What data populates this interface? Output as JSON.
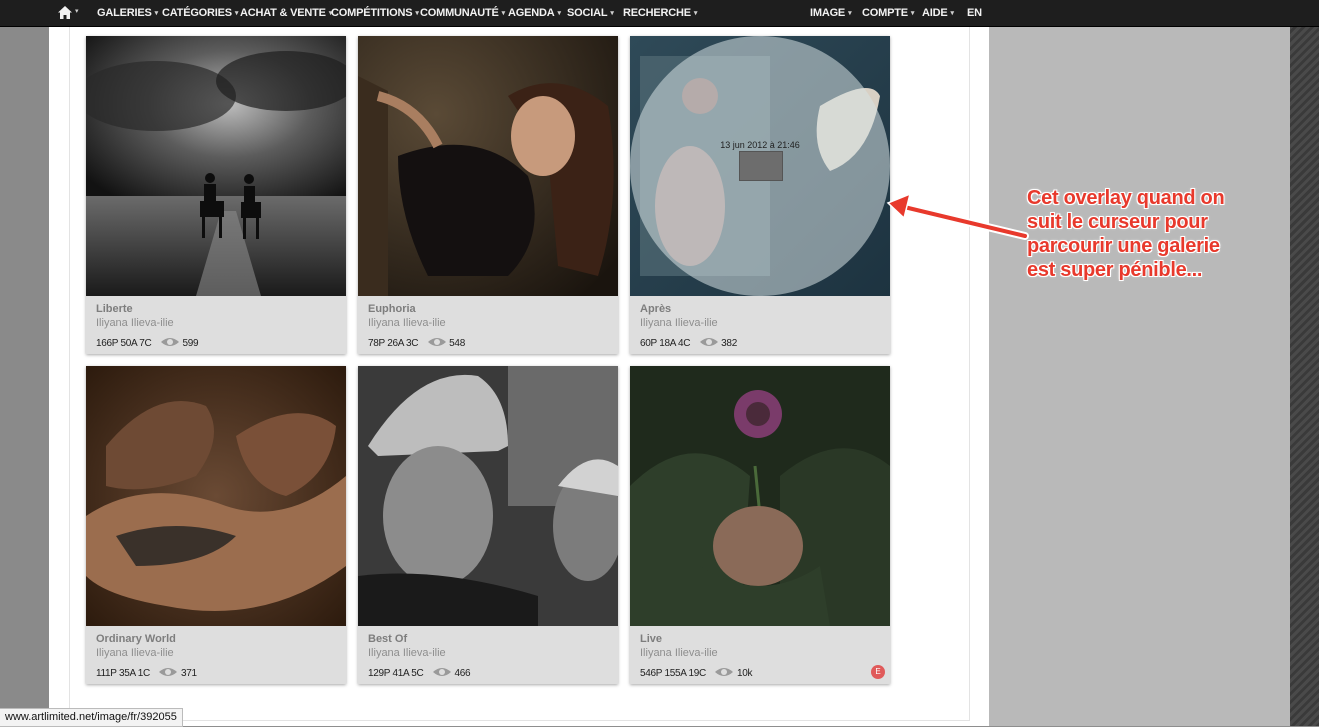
{
  "nav": {
    "left_items": [
      "GALERIES",
      "CATÉGORIES",
      "ACHAT & VENTE",
      "COMPÉTITIONS",
      "COMMUNAUTÉ",
      "AGENDA",
      "SOCIAL",
      "RECHERCHE"
    ],
    "right_items": [
      "IMAGE",
      "COMPTE",
      "AIDE"
    ],
    "language": "EN"
  },
  "cards": [
    {
      "title": "Liberte",
      "author": "Iliyana Ilieva-ilie",
      "stats": "166P 50A 7C",
      "views": "599"
    },
    {
      "title": "Euphoria",
      "author": "Iliyana Ilieva-ilie",
      "stats": "78P 26A 3C",
      "views": "548"
    },
    {
      "title": "Après",
      "author": "Iliyana Ilieva-ilie",
      "stats": "60P 18A 4C",
      "views": "382"
    },
    {
      "title": "Ordinary World",
      "author": "Iliyana Ilieva-ilie",
      "stats": "111P 35A 1C",
      "views": "371"
    },
    {
      "title": "Best Of",
      "author": "Iliyana Ilieva-ilie",
      "stats": "129P 41A 5C",
      "views": "466"
    },
    {
      "title": "Live",
      "author": "Iliyana Ilieva-ilie",
      "stats": "546P 155A 19C",
      "views": "10k",
      "badge": "E"
    }
  ],
  "overlay": {
    "date": "13 jun 2012 à 21:46"
  },
  "annotation": {
    "lines": [
      "Cet overlay quand on",
      "suit le curseur pour",
      "parcourir une galerie",
      "est super pénible..."
    ],
    "color": "#e8392c"
  },
  "status_bar": {
    "url": "www.artlimited.net/image/fr/392055"
  }
}
